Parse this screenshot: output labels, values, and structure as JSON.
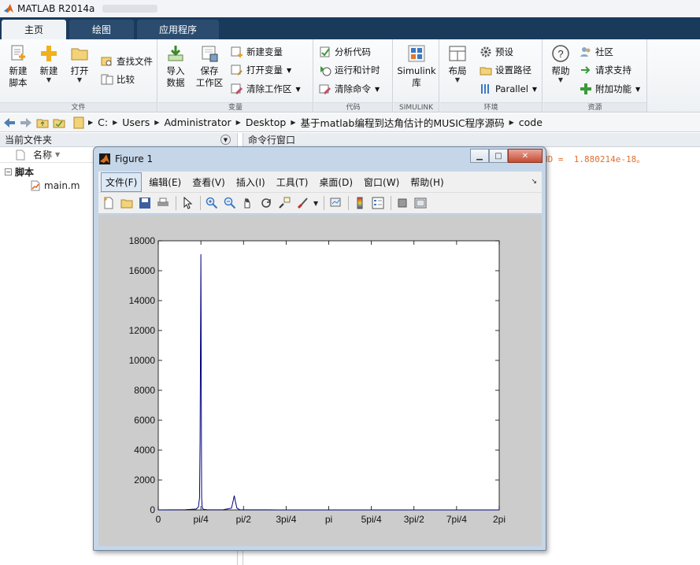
{
  "app": {
    "title": "MATLAB R2014a"
  },
  "tabs": [
    {
      "label": "主页"
    },
    {
      "label": "绘图"
    },
    {
      "label": "应用程序"
    }
  ],
  "ribbon": {
    "file_group": {
      "label": "文件",
      "new_script": "新建\n脚本",
      "new": "新建",
      "open": "打开",
      "find_files": "查找文件",
      "compare": "比较"
    },
    "variable_group": {
      "label": "变量",
      "import_data": "导入\n数据",
      "save_workspace": "保存\n工作区",
      "new_variable": "新建变量",
      "open_variable": "打开变量",
      "clear_workspace": "清除工作区"
    },
    "code_group": {
      "label": "代码",
      "analyze_code": "分析代码",
      "run_and_time": "运行和计时",
      "clear_commands": "清除命令"
    },
    "simulink_group": {
      "label": "SIMULINK",
      "simulink_lib": "Simulink\n库"
    },
    "environment_group": {
      "label": "环境",
      "layout": "布局",
      "preferences": "预设",
      "set_path": "设置路径",
      "parallel": "Parallel"
    },
    "resources_group": {
      "label": "资源",
      "help": "帮助",
      "community": "社区",
      "request_support": "请求支持",
      "addons": "附加功能"
    }
  },
  "address": {
    "crumbs": [
      "C:",
      "Users",
      "Administrator",
      "Desktop",
      "基于matlab编程到达角估计的MUSIC程序源码",
      "code"
    ]
  },
  "current_folder": {
    "title": "当前文件夹",
    "column_name": "名称",
    "folder": "脚本",
    "files": [
      "main.m"
    ]
  },
  "command_window": {
    "title": "命令行窗口",
    "output_fragment": "ND =  1.880214e-18。"
  },
  "figure": {
    "title": "Figure 1",
    "menu": [
      "文件(F)",
      "编辑(E)",
      "查看(V)",
      "插入(I)",
      "工具(T)",
      "桌面(D)",
      "窗口(W)",
      "帮助(H)"
    ],
    "toolbar_icons": [
      "new-figure-icon",
      "open-icon",
      "save-icon",
      "print-icon",
      "pointer-icon",
      "zoom-in-icon",
      "zoom-out-icon",
      "pan-icon",
      "rotate-icon",
      "data-cursor-icon",
      "brush-icon",
      "link-icon",
      "colorbar-icon",
      "legend-icon",
      "hide-tools-icon",
      "show-tools-icon"
    ]
  },
  "chart_data": {
    "type": "line",
    "title": "",
    "xlabel": "",
    "ylabel": "",
    "xlim": [
      0,
      6.2832
    ],
    "ylim": [
      0,
      18000
    ],
    "x_tick_labels": [
      "0",
      "pi/4",
      "pi/2",
      "3pi/4",
      "pi",
      "5pi/4",
      "3pi/2",
      "7pi/4",
      "2pi"
    ],
    "y_tick_labels": [
      "0",
      "2000",
      "4000",
      "6000",
      "8000",
      "10000",
      "12000",
      "14000",
      "16000",
      "18000"
    ],
    "color": "#00007f",
    "series": [
      {
        "x": [
          0,
          0.5,
          0.7,
          0.74,
          0.76,
          0.77,
          0.78,
          0.785,
          0.79,
          0.795,
          0.8,
          0.81,
          0.82,
          0.84,
          0.9,
          1.0,
          1.2,
          1.35,
          1.38,
          1.4,
          1.42,
          1.45,
          1.5,
          1.6,
          2.0,
          2.2,
          2.5,
          3.0,
          3.5,
          4.0,
          5.0,
          6.2832
        ],
        "y": [
          0,
          15,
          60,
          200,
          800,
          4700,
          12900,
          17100,
          13000,
          4500,
          800,
          200,
          80,
          30,
          10,
          5,
          8,
          120,
          600,
          950,
          580,
          120,
          15,
          5,
          3,
          2,
          2,
          1,
          1,
          1,
          1,
          0
        ]
      }
    ]
  }
}
